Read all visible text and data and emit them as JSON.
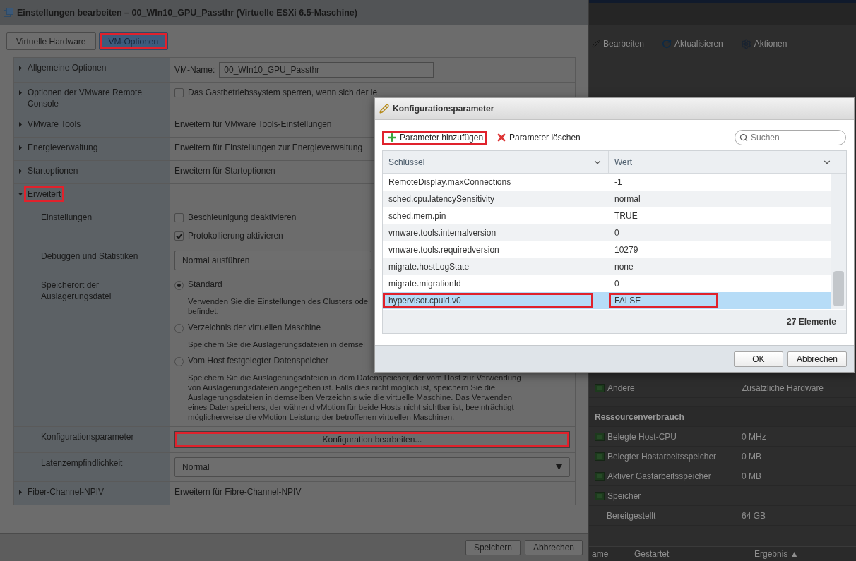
{
  "background_app": {
    "toolbar": [
      {
        "kind": "edit",
        "label": "Bearbeiten"
      },
      {
        "kind": "refresh",
        "label": "Aktualisieren"
      },
      {
        "kind": "actions",
        "label": "Aktionen"
      }
    ],
    "rows": [
      {
        "kind": "item",
        "label": "Andere",
        "value": "Zusätzliche Hardware"
      },
      {
        "kind": "header",
        "label": "Ressourcenverbrauch"
      },
      {
        "kind": "item",
        "label": "Belegte Host-CPU",
        "value": "0 MHz"
      },
      {
        "kind": "item",
        "label": "Belegter Hostarbeitsspeicher",
        "value": "0 MB"
      },
      {
        "kind": "item",
        "label": "Aktiver Gastarbeitsspeicher",
        "value": "0 MB"
      },
      {
        "kind": "item",
        "label": "Speicher"
      },
      {
        "kind": "subitem",
        "label": "Bereitgestellt",
        "value": "64 GB"
      }
    ],
    "columns": [
      "ame",
      "Gestartet",
      "Ergebnis ▲"
    ]
  },
  "dialog": {
    "title": "Einstellungen bearbeiten – 00_WIn10_GPU_Passthr (Virtuelle ESXi 6.5-Maschine)",
    "tabs": [
      {
        "label": "Virtuelle Hardware",
        "selected": false,
        "highlighted": false
      },
      {
        "label": "VM-Optionen",
        "selected": true,
        "highlighted": true
      }
    ],
    "sections": [
      {
        "label": "Allgemeine Optionen",
        "expanded": false,
        "highlighted": false,
        "content": {
          "kind": "input",
          "label": "VM-Name:",
          "value": "00_WIn10_GPU_Passthr"
        }
      },
      {
        "label": "Optionen der VMware Remote Console",
        "expanded": false,
        "highlighted": false,
        "content": {
          "kind": "checkboxes",
          "items": [
            {
              "label": "Das Gastbetriebssystem sperren, wenn sich der le",
              "checked": false
            }
          ]
        }
      },
      {
        "label": "VMware Tools",
        "expanded": false,
        "highlighted": false,
        "content": {
          "kind": "text",
          "text": "Erweitern für VMware Tools-Einstellungen"
        }
      },
      {
        "label": "Energieverwaltung",
        "expanded": false,
        "highlighted": false,
        "content": {
          "kind": "text",
          "text": "Erweitern für Einstellungen zur Energieverwaltung"
        }
      },
      {
        "label": "Startoptionen",
        "expanded": false,
        "highlighted": false,
        "content": {
          "kind": "text",
          "text": "Erweitern für Startoptionen"
        }
      },
      {
        "label": "Erweitert",
        "expanded": true,
        "highlighted": true,
        "children": [
          {
            "label": "Einstellungen",
            "content": {
              "kind": "checkboxes",
              "items": [
                {
                  "label": "Beschleunigung deaktivieren",
                  "checked": false
                },
                {
                  "label": "Protokollierung aktivieren",
                  "checked": true
                }
              ]
            }
          },
          {
            "label": "Debuggen und Statistiken",
            "content": {
              "kind": "select",
              "value": "Normal ausführen",
              "covered": true
            }
          },
          {
            "label": "Speicherort der Auslagerungsdatei",
            "content": {
              "kind": "radios",
              "options": [
                {
                  "label": "Standard",
                  "description": "Verwenden Sie die Einstellungen des Clusters ode\nbefindet.",
                  "selected": true
                },
                {
                  "label": "Verzeichnis der virtuellen Maschine",
                  "description": "Speichern Sie die Auslagerungsdateien in demsel",
                  "selected": false
                },
                {
                  "label": "Vom Host festgelegter Datenspeicher",
                  "description": "Speichern Sie die Auslagerungsdateien in dem Datenspeicher, der vom Host zur Verwendung\nvon Auslagerungsdateien angegeben ist. Falls dies nicht möglich ist, speichern Sie die\nAuslagerungsdateien in demselben Verzeichnis wie die virtuelle Maschine. Das Verwenden\neines Datenspeichers, der während vMotion für beide Hosts nicht sichtbar ist, beeinträchtigt\nmöglicherweise die vMotion-Leistung der betroffenen virtuellen Maschinen.",
                  "selected": false
                }
              ]
            }
          },
          {
            "label": "Konfigurationsparameter",
            "content": {
              "kind": "button",
              "label": "Konfiguration bearbeiten...",
              "highlighted": true
            }
          },
          {
            "label": "Latenzempfindlichkeit",
            "content": {
              "kind": "select",
              "value": "Normal",
              "covered": false
            }
          }
        ]
      },
      {
        "label": "Fiber-Channel-NPIV",
        "expanded": false,
        "highlighted": false,
        "content": {
          "kind": "text",
          "text": "Erweitern für Fibre-Channel-NPIV"
        }
      }
    ],
    "buttons": [
      "Speichern",
      "Abbrechen"
    ]
  },
  "config_dialog": {
    "title": "Konfigurationsparameter",
    "toolbar": [
      {
        "kind": "add",
        "label": "Parameter hinzufügen",
        "highlighted": true
      },
      {
        "kind": "delete",
        "label": "Parameter löschen",
        "highlighted": false
      }
    ],
    "search": {
      "placeholder": "Suchen"
    },
    "columns": [
      "Schlüssel",
      "Wert"
    ],
    "rows": [
      {
        "key": "RemoteDisplay.maxConnections",
        "value": "-1",
        "selected": false,
        "highlighted": false
      },
      {
        "key": "sched.cpu.latencySensitivity",
        "value": "normal",
        "selected": false,
        "highlighted": false
      },
      {
        "key": "sched.mem.pin",
        "value": "TRUE",
        "selected": false,
        "highlighted": false
      },
      {
        "key": "vmware.tools.internalversion",
        "value": "0",
        "selected": false,
        "highlighted": false
      },
      {
        "key": "vmware.tools.requiredversion",
        "value": "10279",
        "selected": false,
        "highlighted": false
      },
      {
        "key": "migrate.hostLogState",
        "value": "none",
        "selected": false,
        "highlighted": false
      },
      {
        "key": "migrate.migrationId",
        "value": "0",
        "selected": false,
        "highlighted": false
      },
      {
        "key": "hypervisor.cpuid.v0",
        "value": "FALSE",
        "selected": true,
        "highlighted": true
      }
    ],
    "count": "27 Elemente",
    "buttons": [
      "OK",
      "Abbrechen"
    ]
  }
}
